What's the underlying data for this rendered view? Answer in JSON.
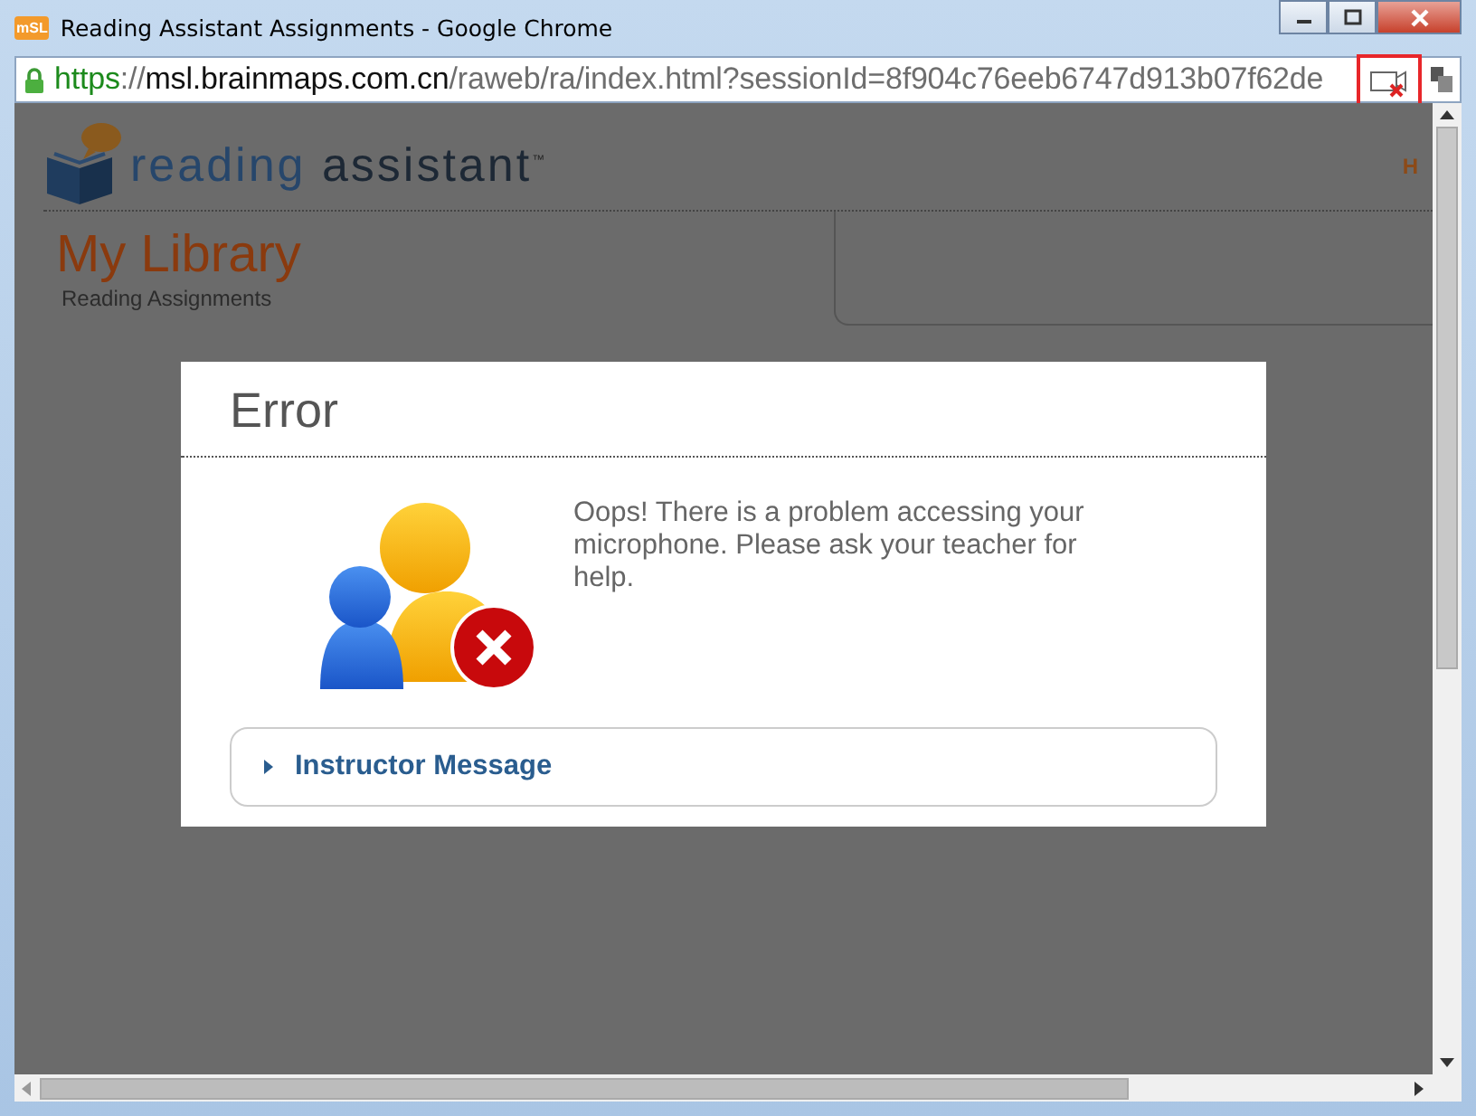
{
  "window": {
    "title": "Reading Assistant Assignments - Google Chrome",
    "favicon": "mSL"
  },
  "address_bar": {
    "scheme": "https",
    "separator": "://",
    "host": "msl.brainmaps.com.cn",
    "path": "/raweb/ra/index.html?sessionId=8f904c76eeb6747d913b07f62de",
    "mic_blocked": true
  },
  "page": {
    "logo": {
      "word_1": "reading",
      "word_2": "assistant",
      "mark": "™"
    },
    "nav_text": "H",
    "heading": "My Library",
    "subheading": "Reading Assignments"
  },
  "dialog": {
    "title": "Error",
    "message": "Oops! There is a problem accessing your microphone. Please ask your teacher for help.",
    "instructor_message": {
      "label": "Instructor Message",
      "expanded": false
    }
  }
}
